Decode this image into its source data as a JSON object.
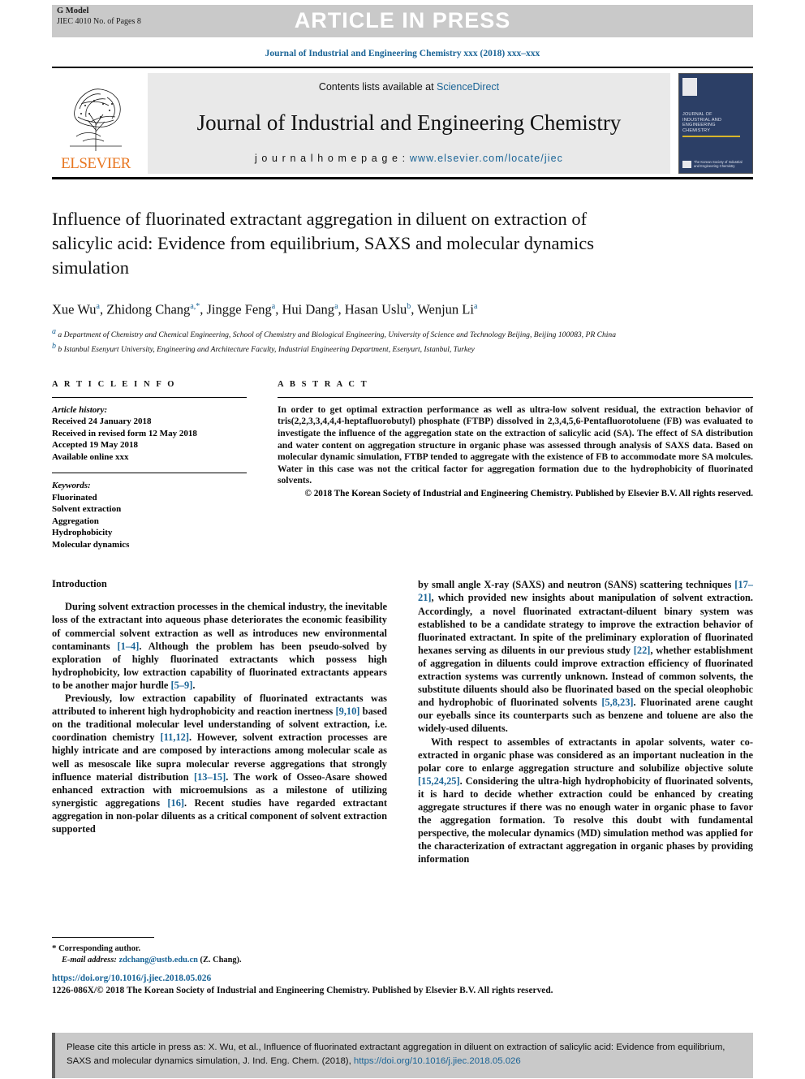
{
  "banner": {
    "g_model": "G Model",
    "g_model_sub": "JIEC 4010 No. of Pages 8",
    "title": "ARTICLE IN PRESS"
  },
  "journal_line": "Journal of Industrial and Engineering Chemistry xxx (2018) xxx–xxx",
  "masthead": {
    "contents_prefix": "Contents lists available at ",
    "sciencedirect": "ScienceDirect",
    "journal_name": "Journal of Industrial and Engineering Chemistry",
    "homepage_prefix": "j o u r n a l h o m e p a g e : ",
    "homepage_url": "www.elsevier.com/locate/jiec",
    "elsevier_word": "ELSEVIER",
    "cover_title": "JOURNAL OF\nINDUSTRIAL AND\nENGINEERING\nCHEMISTRY",
    "cover_bottom": "The Korean Society of Industrial\nand Engineering Chemistry"
  },
  "article": {
    "title": "Influence of fluorinated extractant aggregation in diluent on extraction of salicylic acid: Evidence from equilibrium, SAXS and molecular dynamics simulation",
    "authors_html": "Xue Wu<sup>a</sup>, Zhidong Chang<sup>a,*</sup>, Jingge Feng<sup>a</sup>, Hui Dang<sup>a</sup>, Hasan Uslu<sup>b</sup>, Wenjun Li<sup>a</sup>",
    "affiliation_a": "a Department of Chemistry and Chemical Engineering, School of Chemistry and Biological Engineering, University of Science and Technology Beijing, Beijing 100083, PR China",
    "affiliation_b": "b Istanbul Esenyurt University, Engineering and Architecture Faculty, Industrial Engineering Department, Esenyurt, Istanbul, Turkey"
  },
  "article_info": {
    "heading": "A R T I C L E   I N F O",
    "history_label": "Article history:",
    "history": [
      "Received 24 January 2018",
      "Received in revised form 12 May 2018",
      "Accepted 19 May 2018",
      "Available online xxx"
    ],
    "keywords_label": "Keywords:",
    "keywords": [
      "Fluorinated",
      "Solvent extraction",
      "Aggregation",
      "Hydrophobicity",
      "Molecular dynamics"
    ]
  },
  "abstract": {
    "heading": "A B S T R A C T",
    "text": "In order to get optimal extraction performance as well as ultra-low solvent residual, the extraction behavior of tris(2,2,3,3,4,4,4-heptafluorobutyl) phosphate (FTBP) dissolved in 2,3,4,5,6-Pentafluorotoluene (FB) was evaluated to investigate the influence of the aggregation state on the extraction of salicylic acid (SA). The effect of SA distribution and water content on aggregation structure in organic phase was assessed through analysis of SAXS data. Based on molecular dynamic simulation, FTBP tended to aggregate with the existence of FB to accommodate more SA molcules. Water in this case was not the critical factor for aggregation formation due to the hydrophobicity of fluorinated solvents.",
    "copyright": "© 2018 The Korean Society of Industrial and Engineering Chemistry. Published by Elsevier B.V. All rights reserved."
  },
  "body": {
    "intro_heading": "Introduction",
    "left_paragraphs": [
      "During solvent extraction processes in the chemical industry, the inevitable loss of the extractant into aqueous phase deteriorates the economic feasibility of commercial solvent extraction as well as introduces new environmental contaminants [1–4]. Although the problem has been pseudo-solved by exploration of highly fluorinated extractants which possess high hydrophobicity, low extraction capability of fluorinated extractants appears to be another major hurdle [5–9].",
      "Previously, low extraction capability of fluorinated extractants was attributed to inherent high hydrophobicity and reaction inertness [9,10] based on the traditional molecular level understanding of solvent extraction, i.e. coordination chemistry [11,12]. However, solvent extraction processes are highly intricate and are composed by interactions among molecular scale as well as mesoscale like supra molecular reverse aggregations that strongly influence material distribution [13–15]. The work of Osseo-Asare showed enhanced extraction with microemulsions as a milestone of utilizing synergistic aggregations [16]. Recent studies have regarded extractant aggregation in non-polar diluents as a critical component of solvent extraction supported"
    ],
    "right_paragraphs": [
      "by small angle X-ray (SAXS) and neutron (SANS) scattering techniques [17–21], which provided new insights about manipulation of solvent extraction. Accordingly, a novel fluorinated extractant-diluent binary system was established to be a candidate strategy to improve the extraction behavior of fluorinated extractant. In spite of the preliminary exploration of fluorinated hexanes serving as diluents in our previous study [22], whether establishment of aggregation in diluents could improve extraction efficiency of fluorinated extraction systems was currently unknown. Instead of common solvents, the substitute diluents should also be fluorinated based on the special oleophobic and hydrophobic of fluorinated solvents [5,8,23]. Fluorinated arene caught our eyeballs since its counterparts such as benzene and toluene are also the widely-used diluents.",
      "With respect to assembles of extractants in apolar solvents, water co-extracted in organic phase was considered as an important nucleation in the polar core to enlarge aggregation structure and solubilize objective solute [15,24,25]. Considering the ultra-high hydrophobicity of fluorinated solvents, it is hard to decide whether extraction could be enhanced by creating aggregate structures if there was no enough water in organic phase to favor the aggregation formation. To resolve this doubt with fundamental perspective, the molecular dynamics (MD) simulation method was applied for the characterization of extractant aggregation in organic phases by providing information"
    ]
  },
  "footnotes": {
    "corresponding": "Corresponding author.",
    "email_label": "E-mail address:",
    "email": "zdchang@ustb.edu.cn",
    "email_suffix": "(Z. Chang)."
  },
  "doi_block": {
    "doi": "https://doi.org/10.1016/j.jiec.2018.05.026",
    "copyright": "1226-086X/© 2018 The Korean Society of Industrial and Engineering Chemistry. Published by Elsevier B.V. All rights reserved."
  },
  "cite_box": {
    "text_part1": "Please cite this article in press as: X. Wu, et al., Influence of fluorinated extractant aggregation in diluent on extraction of salicylic acid: Evidence from equilibrium, SAXS and molecular dynamics simulation, J. Ind. Eng. Chem. (2018), ",
    "link": "https://doi.org/10.1016/j.jiec.2018.05.026"
  },
  "colors": {
    "link": "#1a6496",
    "banner_bg": "#c9c9c9",
    "elsevier_orange": "#e87722",
    "cover_blue": "#2c3f66"
  }
}
